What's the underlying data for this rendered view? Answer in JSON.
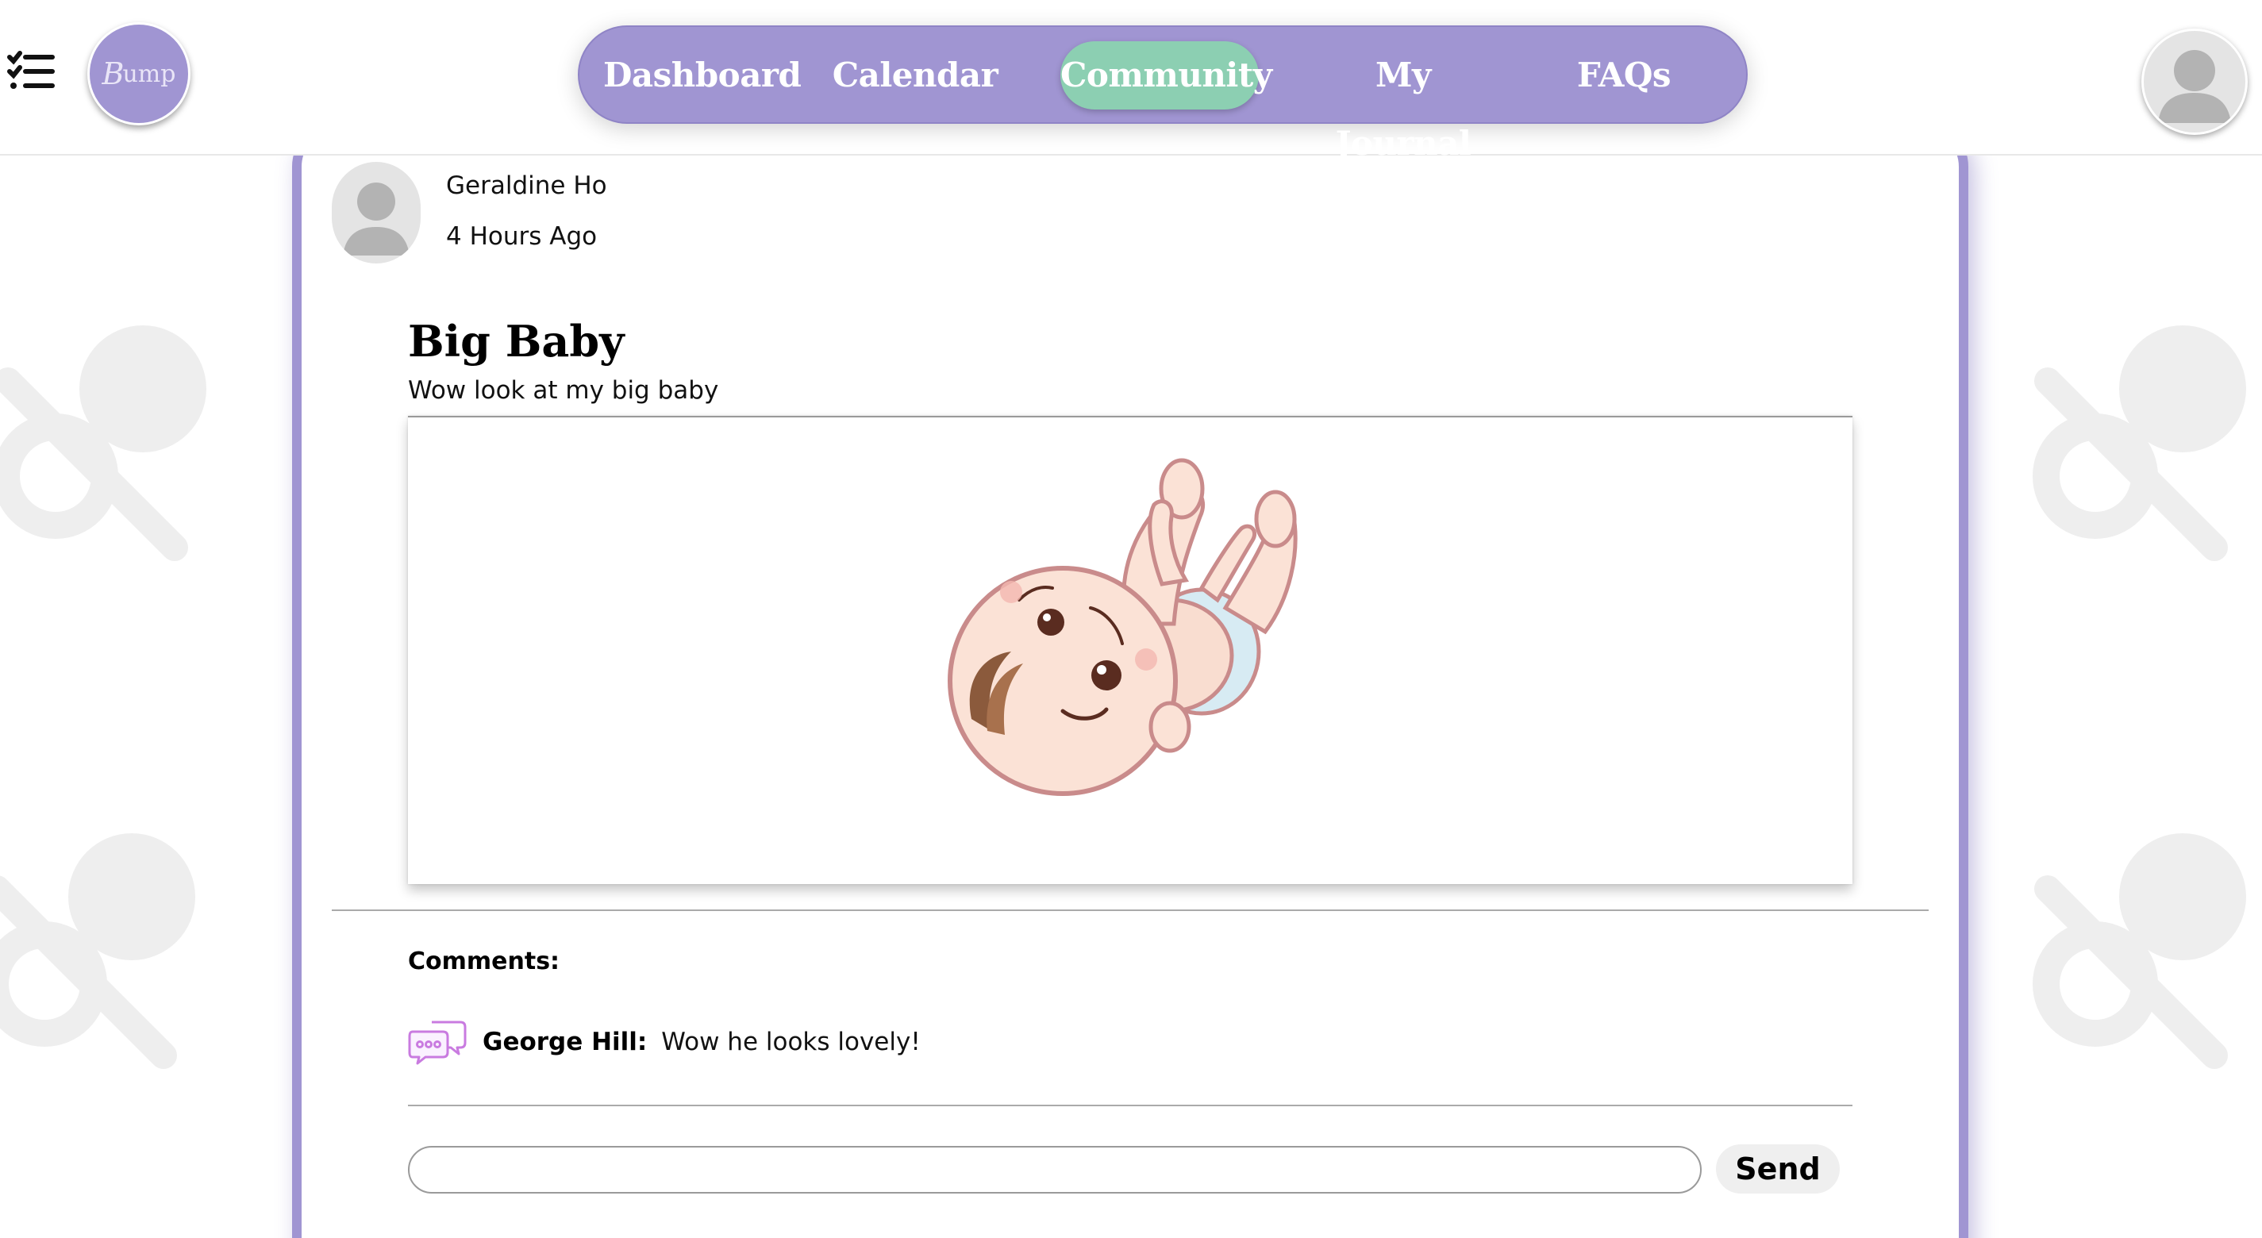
{
  "app": {
    "logo_text": "ump",
    "logo_mark": "B"
  },
  "colors": {
    "accent": "#a095d2",
    "active_tab": "#8ccfb2",
    "background_decor": "#eeeeee",
    "comment_icon": "#c97be0"
  },
  "nav": {
    "items": [
      {
        "label": "Dashboard",
        "active": false
      },
      {
        "label": "Calendar",
        "active": false
      },
      {
        "label": "Community",
        "active": true
      },
      {
        "label": "My Journal",
        "active": false
      },
      {
        "label": "FAQs",
        "active": false
      }
    ]
  },
  "icons": {
    "menu": "checklist-menu-icon",
    "avatar": "user-avatar-icon",
    "comment": "chat-bubbles-icon",
    "decor": "pacifier-icon"
  },
  "post": {
    "author": "Geraldine Ho",
    "time": "4 Hours Ago",
    "title": "Big Baby",
    "body": "Wow look at my big baby",
    "image": "cartoon-baby-illustration"
  },
  "comments": {
    "heading": "Comments:",
    "items": [
      {
        "author": "George Hill:",
        "text": "Wow he looks lovely!"
      }
    ],
    "input_value": "",
    "input_placeholder": "",
    "send_label": "Send"
  }
}
